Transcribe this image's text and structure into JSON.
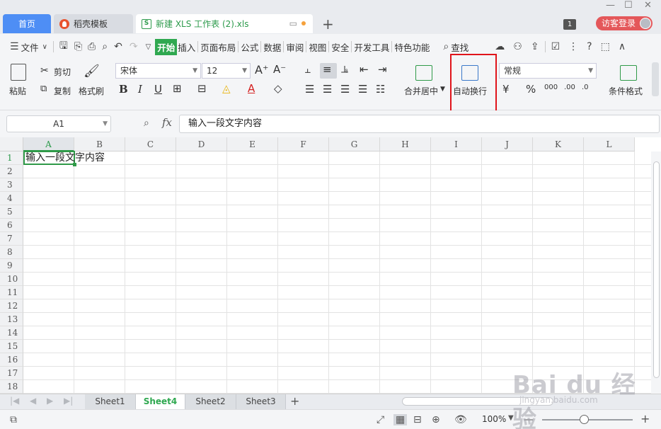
{
  "tabs": {
    "home": "首页",
    "template": "稻壳模板",
    "file": "新建 XLS 工作表 (2).xls",
    "badge": "1",
    "login": "访客登录"
  },
  "menu": {
    "file": "文件",
    "items": [
      "开始",
      "插入",
      "页面布局",
      "公式",
      "数据",
      "审阅",
      "视图",
      "安全",
      "开发工具",
      "特色功能"
    ],
    "search": "查找"
  },
  "ribbon": {
    "paste": "粘贴",
    "cut": "剪切",
    "copy": "复制",
    "format_painter": "格式刷",
    "font_name": "宋体",
    "font_size": "12",
    "merge_center": "合并居中",
    "wrap_text": "自动换行",
    "number_format": "常规",
    "conditional_format": "条件格式"
  },
  "formula_bar": {
    "name_box": "A1",
    "fx": "fx",
    "content": "输入一段文字内容"
  },
  "grid": {
    "columns": [
      "A",
      "B",
      "C",
      "D",
      "E",
      "F",
      "G",
      "H",
      "I",
      "J",
      "K",
      "L"
    ],
    "rows": [
      "1",
      "2",
      "3",
      "4",
      "5",
      "6",
      "7",
      "8",
      "9",
      "10",
      "11",
      "12",
      "13",
      "14",
      "15",
      "16",
      "17",
      "18"
    ],
    "selected_cell": "A1",
    "cell_a1": "输入一段文字内容"
  },
  "sheets": [
    "Sheet1",
    "Sheet4",
    "Sheet2",
    "Sheet3"
  ],
  "active_sheet": "Sheet4",
  "status": {
    "zoom": "100%",
    "zoom_level": 1.0
  },
  "watermark": {
    "brand": "Bai du 经验",
    "url": "jingyan.baidu.com"
  },
  "colors": {
    "accent_green": "#2fa850",
    "home_tab": "#4e8ef5",
    "highlight_box": "#e0141b",
    "login": "#e4575a"
  }
}
